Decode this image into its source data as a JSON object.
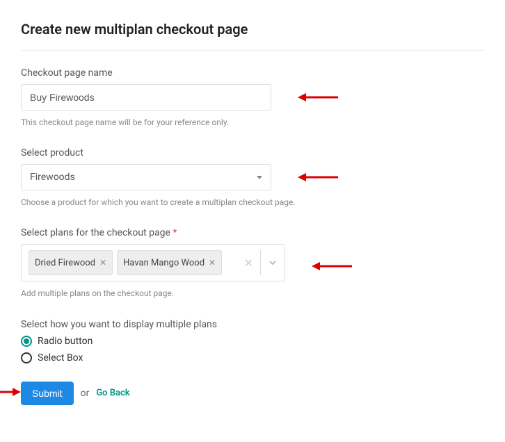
{
  "title": "Create new multiplan checkout page",
  "checkoutName": {
    "label": "Checkout page name",
    "value": "Buy Firewoods",
    "help": "This checkout page name will be for your reference only."
  },
  "product": {
    "label": "Select product",
    "selected": "Firewoods",
    "help": "Choose a product for which you want to create a multiplan checkout page."
  },
  "plans": {
    "label": "Select plans for the checkout page",
    "tags": [
      "Dried Firewood",
      "Havan Mango Wood"
    ],
    "help": "Add multiple plans on the checkout page."
  },
  "display": {
    "label": "Select how you want to display multiple plans",
    "options": [
      {
        "label": "Radio button",
        "selected": true
      },
      {
        "label": "Select Box",
        "selected": false
      }
    ]
  },
  "actions": {
    "submit": "Submit",
    "or": "or",
    "goBack": "Go Back"
  }
}
